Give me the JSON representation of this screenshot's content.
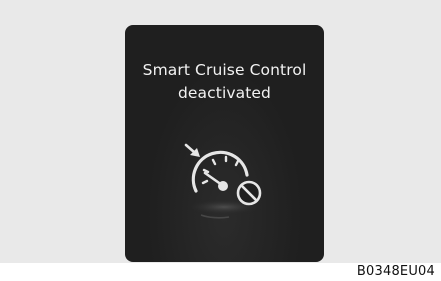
{
  "display": {
    "message_line1": "Smart Cruise Control",
    "message_line2": "deactivated",
    "icon": "cruise-control-deactivated-icon",
    "background_color": "#1f1f1f",
    "text_color": "#f2f2f2"
  },
  "figure_code": "B0348EU04"
}
